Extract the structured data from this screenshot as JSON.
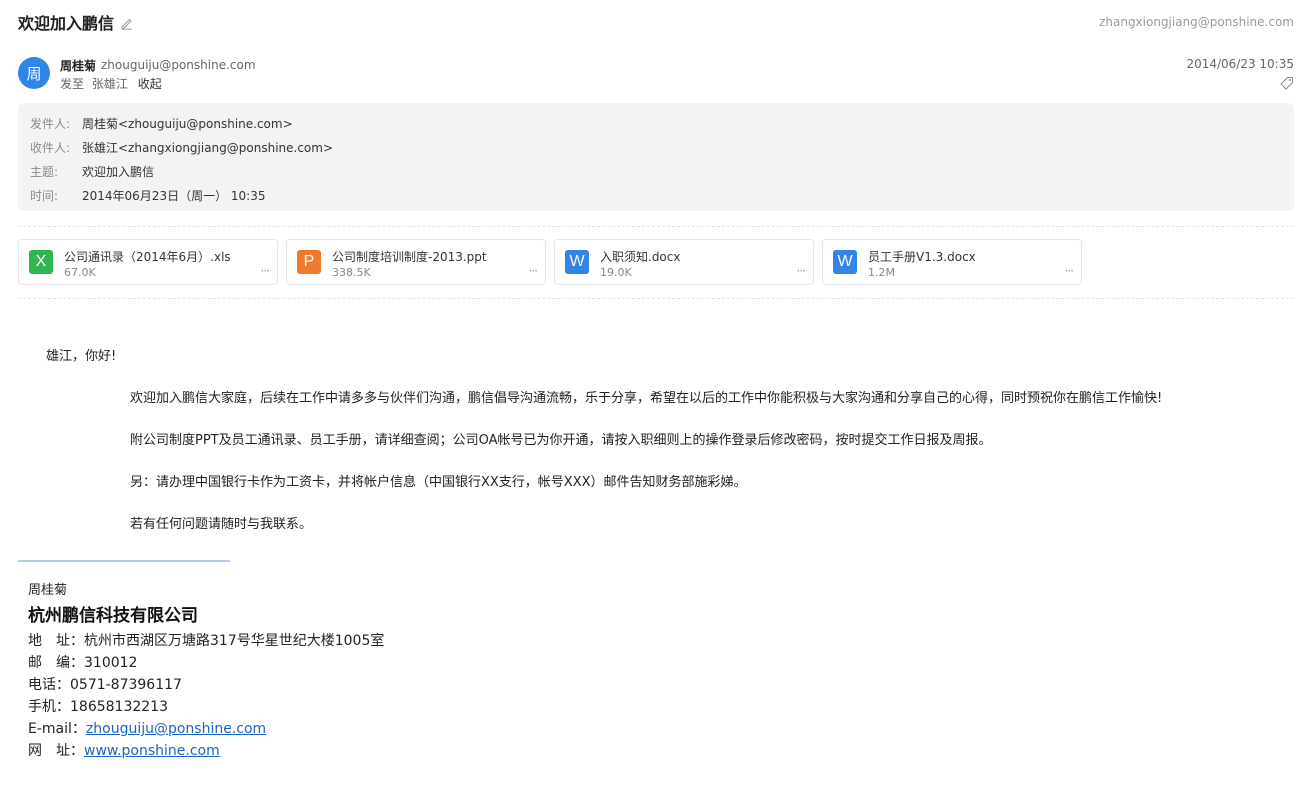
{
  "header": {
    "subject": "欢迎加入鹏信",
    "account": "zhangxiongjiang@ponshine.com"
  },
  "sender": {
    "avatar_char": "周",
    "name": "周桂菊",
    "email": "zhouguiju@ponshine.com",
    "sendto_label": "发至",
    "recipient": "张雄江",
    "collapse_label": "收起",
    "date": "2014/06/23 10:35"
  },
  "details": [
    {
      "label": "发件人:",
      "value": "周桂菊<zhouguiju@ponshine.com>"
    },
    {
      "label": "收件人:",
      "value": "张雄江<zhangxiongjiang@ponshine.com>"
    },
    {
      "label": "主题:",
      "value": "欢迎加入鹏信"
    },
    {
      "label": "时间:",
      "value": "2014年06月23日（周一） 10:35"
    }
  ],
  "attachments": [
    {
      "icon": "X",
      "name": "公司通讯录（2014年6月）.xls",
      "size": "67.0K",
      "color": "#2fb552"
    },
    {
      "icon": "P",
      "name": "公司制度培训制度-2013.ppt",
      "size": "338.5K",
      "color": "#f07a2c"
    },
    {
      "icon": "W",
      "name": "入职须知.docx",
      "size": "19.0K",
      "color": "#2f86e6"
    },
    {
      "icon": "W",
      "name": "员工手册V1.3.docx",
      "size": "1.2M",
      "color": "#2f86e6"
    }
  ],
  "body": {
    "greeting": "雄江，你好!",
    "paragraphs": [
      "欢迎加入鹏信大家庭，后续在工作中请多多与伙伴们沟通，鹏信倡导沟通流畅，乐于分享，希望在以后的工作中你能积极与大家沟通和分享自己的心得，同时预祝你在鹏信工作愉快!",
      "附公司制度PPT及员工通讯录、员工手册，请详细查阅；公司OA帐号已为你开通，请按入职细则上的操作登录后修改密码，按时提交工作日报及周报。",
      "另：请办理中国银行卡作为工资卡，并将帐户信息（中国银行XX支行，帐号XXX）邮件告知财务部施彩娣。",
      "若有任何问题请随时与我联系。"
    ]
  },
  "signature": {
    "name": "周桂菊",
    "company": "杭州鹏信科技有限公司",
    "address": "地　址：杭州市西湖区万塘路317号华星世纪大楼1005室",
    "postcode": "邮　编：310012",
    "phone": "电话：0571-87396117",
    "mobile": "手机：18658132213",
    "email_label": "E-mail：",
    "email": "zhouguiju@ponshine.com",
    "web_label": "网　址：",
    "web": "www.ponshine.com"
  }
}
